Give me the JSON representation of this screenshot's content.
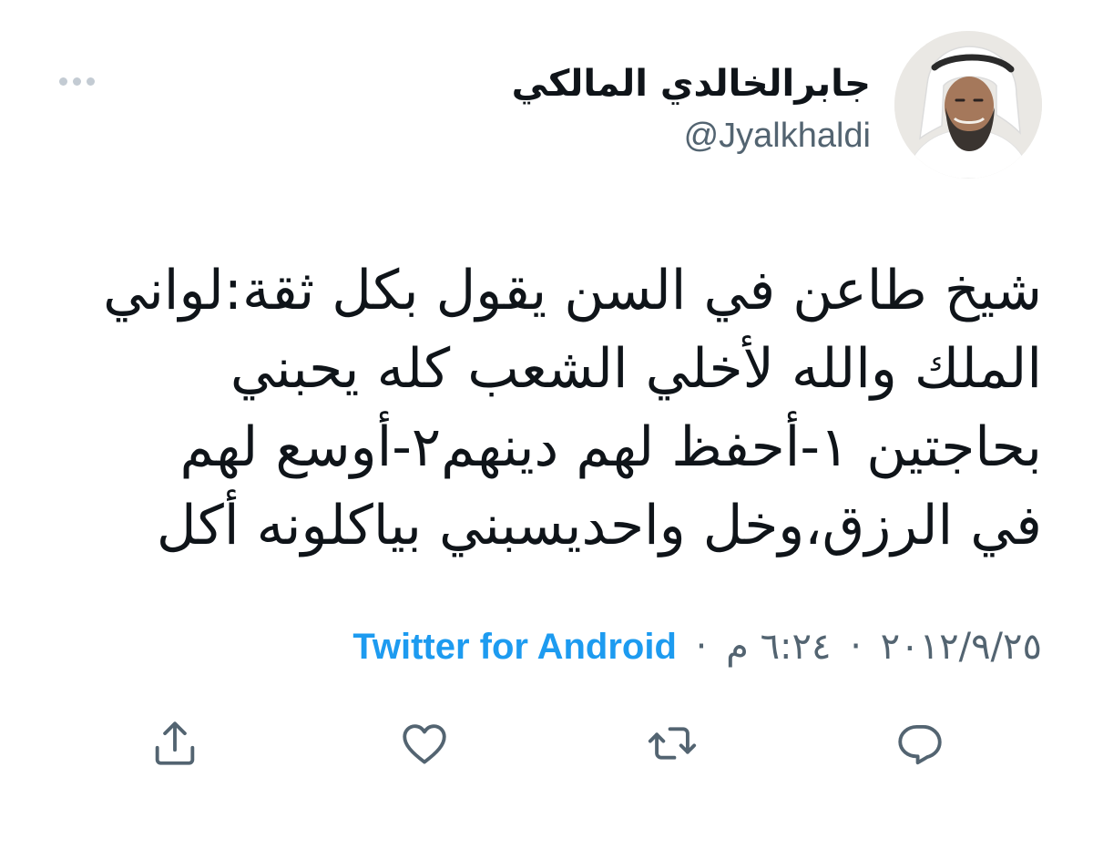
{
  "more_icon": "more-horizontal-icon",
  "user": {
    "display_name": "جابرالخالدي المالكي",
    "handle": "@Jyalkhaldi",
    "avatar": "profile-photo"
  },
  "tweet": {
    "lines": [
      "شيخ طاعن في السن يقول بكل ثقة:لواني",
      "الملك والله لأخلي الشعب كله يحبني",
      "بحاجتين ١-أحفظ لهم دينهم٢-أوسع لهم",
      "في الرزق،وخل واحديسبني بياكلونه أكل"
    ]
  },
  "meta": {
    "date": "٢٠١٢/٩/٢٥",
    "time": "٦:٢٤ م",
    "separator": "·",
    "source": "Twitter for Android"
  },
  "actions": [
    {
      "name": "reply",
      "icon": "reply-icon"
    },
    {
      "name": "retweet",
      "icon": "retweet-icon"
    },
    {
      "name": "like",
      "icon": "heart-icon"
    },
    {
      "name": "share",
      "icon": "share-icon"
    }
  ],
  "colors": {
    "text": "#0f1419",
    "secondary": "#536471",
    "accent": "#1d9bf0",
    "icon": "#536471"
  }
}
